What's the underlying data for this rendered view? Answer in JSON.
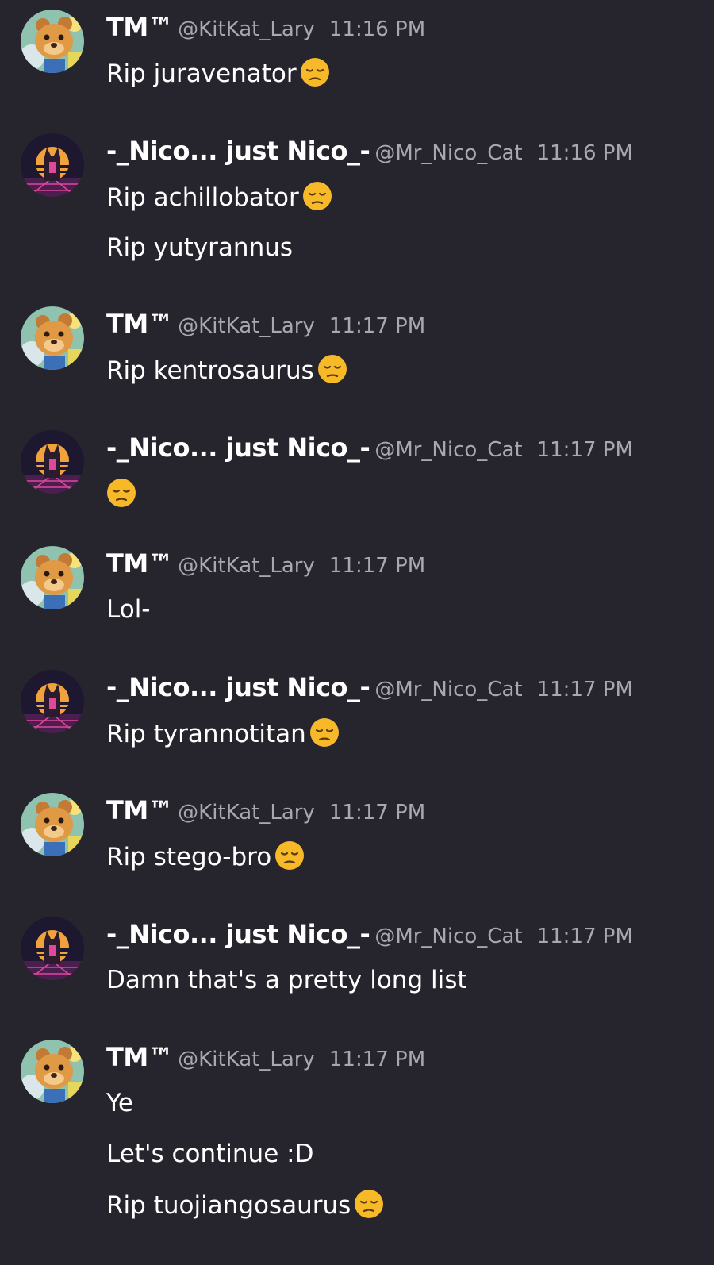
{
  "colors": {
    "background": "#26252d",
    "text": "#ffffff",
    "muted": "#a9a8b1",
    "emoji_face": "#f7b928"
  },
  "users": {
    "tm": {
      "display_name": "TM™",
      "handle": "@KitKat_Lary",
      "avatar_icon": "bear-character-avatar"
    },
    "nico": {
      "display_name": "-_Nico... just Nico_-",
      "handle": "@Mr_Nico_Cat",
      "avatar_icon": "retro-sunset-cat-avatar"
    }
  },
  "messages": [
    {
      "user": "tm",
      "display_name": "TM™",
      "handle": "@KitKat_Lary",
      "time": "11:16 PM",
      "lines": [
        {
          "text": "Rip juravenator",
          "emoji": "pensive-face-emoji"
        }
      ]
    },
    {
      "user": "nico",
      "display_name": "-_Nico... just Nico_-",
      "handle": "@Mr_Nico_Cat",
      "time": "11:16 PM",
      "lines": [
        {
          "text": "Rip achillobator",
          "emoji": "pensive-face-emoji"
        },
        {
          "text": "Rip yutyrannus",
          "emoji": ""
        }
      ]
    },
    {
      "user": "tm",
      "display_name": "TM™",
      "handle": "@KitKat_Lary",
      "time": "11:17 PM",
      "lines": [
        {
          "text": "Rip kentrosaurus",
          "emoji": "pensive-face-emoji"
        }
      ]
    },
    {
      "user": "nico",
      "display_name": "-_Nico... just Nico_-",
      "handle": "@Mr_Nico_Cat",
      "time": "11:17 PM",
      "lines": [
        {
          "text": "",
          "emoji": "pensive-face-emoji"
        }
      ]
    },
    {
      "user": "tm",
      "display_name": "TM™",
      "handle": "@KitKat_Lary",
      "time": "11:17 PM",
      "lines": [
        {
          "text": "Lol-",
          "emoji": ""
        }
      ]
    },
    {
      "user": "nico",
      "display_name": "-_Nico... just Nico_-",
      "handle": "@Mr_Nico_Cat",
      "time": "11:17 PM",
      "lines": [
        {
          "text": "Rip tyrannotitan",
          "emoji": "pensive-face-emoji"
        }
      ]
    },
    {
      "user": "tm",
      "display_name": "TM™",
      "handle": "@KitKat_Lary",
      "time": "11:17 PM",
      "lines": [
        {
          "text": "Rip stego-bro",
          "emoji": "pensive-face-emoji"
        }
      ]
    },
    {
      "user": "nico",
      "display_name": "-_Nico... just Nico_-",
      "handle": "@Mr_Nico_Cat",
      "time": "11:17 PM",
      "lines": [
        {
          "text": "Damn that's a pretty long list",
          "emoji": ""
        }
      ]
    },
    {
      "user": "tm",
      "display_name": "TM™",
      "handle": "@KitKat_Lary",
      "time": "11:17 PM",
      "lines": [
        {
          "text": "Ye",
          "emoji": ""
        },
        {
          "text": "Let's continue :D",
          "emoji": ""
        },
        {
          "text": "Rip tuojiangosaurus",
          "emoji": "pensive-face-emoji"
        }
      ]
    }
  ]
}
